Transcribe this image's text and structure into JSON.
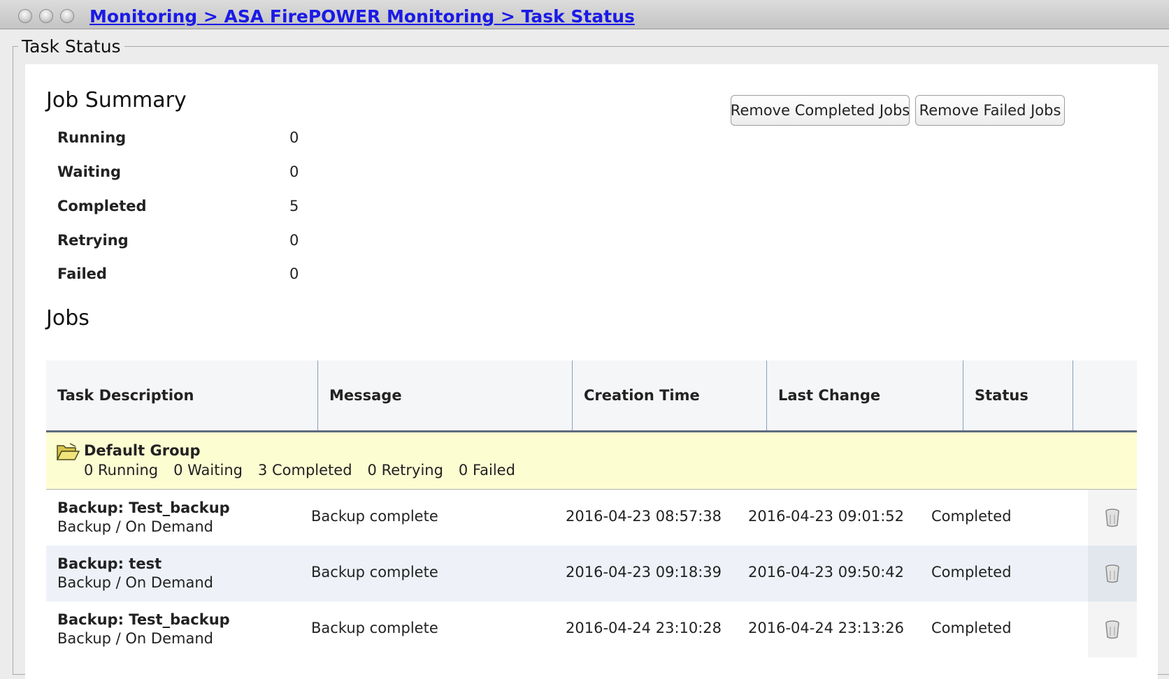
{
  "window": {
    "breadcrumb": "Monitoring > ASA FirePOWER Monitoring > Task Status"
  },
  "section_legend": "Task Status",
  "job_summary": {
    "title": "Job Summary",
    "remove_completed_label": "Remove Completed Jobs",
    "remove_failed_label": "Remove Failed Jobs",
    "rows": [
      {
        "label": "Running",
        "value": "0"
      },
      {
        "label": "Waiting",
        "value": "0"
      },
      {
        "label": "Completed",
        "value": "5"
      },
      {
        "label": "Retrying",
        "value": "0"
      },
      {
        "label": "Failed",
        "value": "0"
      }
    ]
  },
  "jobs": {
    "title": "Jobs",
    "columns": [
      "Task Description",
      "Message",
      "Creation Time",
      "Last Change",
      "Status"
    ],
    "group": {
      "name": "Default Group",
      "icon": "open-folder-icon",
      "counts": [
        "0 Running",
        "0 Waiting",
        "3 Completed",
        "0 Retrying",
        "0 Failed"
      ]
    },
    "rows": [
      {
        "task": "Backup: Test_backup",
        "subtask": "Backup / On Demand",
        "message": "Backup complete",
        "created": "2016-04-23 08:57:38",
        "changed": "2016-04-23 09:01:52",
        "status": "Completed",
        "icon": "trash-icon"
      },
      {
        "task": "Backup: test",
        "subtask": "Backup / On Demand",
        "message": "Backup complete",
        "created": "2016-04-23 09:18:39",
        "changed": "2016-04-23 09:50:42",
        "status": "Completed",
        "icon": "trash-icon"
      },
      {
        "task": "Backup: Test_backup",
        "subtask": "Backup / On Demand",
        "message": "Backup complete",
        "created": "2016-04-24 23:10:28",
        "changed": "2016-04-24 23:13:26",
        "status": "Completed",
        "icon": "trash-icon"
      }
    ]
  },
  "colors": {
    "link": "#1a1ae6",
    "group_bg": "#fdfdd2",
    "alt_row_bg": "#eef2f8",
    "header_rule": "#5e6c7d"
  }
}
